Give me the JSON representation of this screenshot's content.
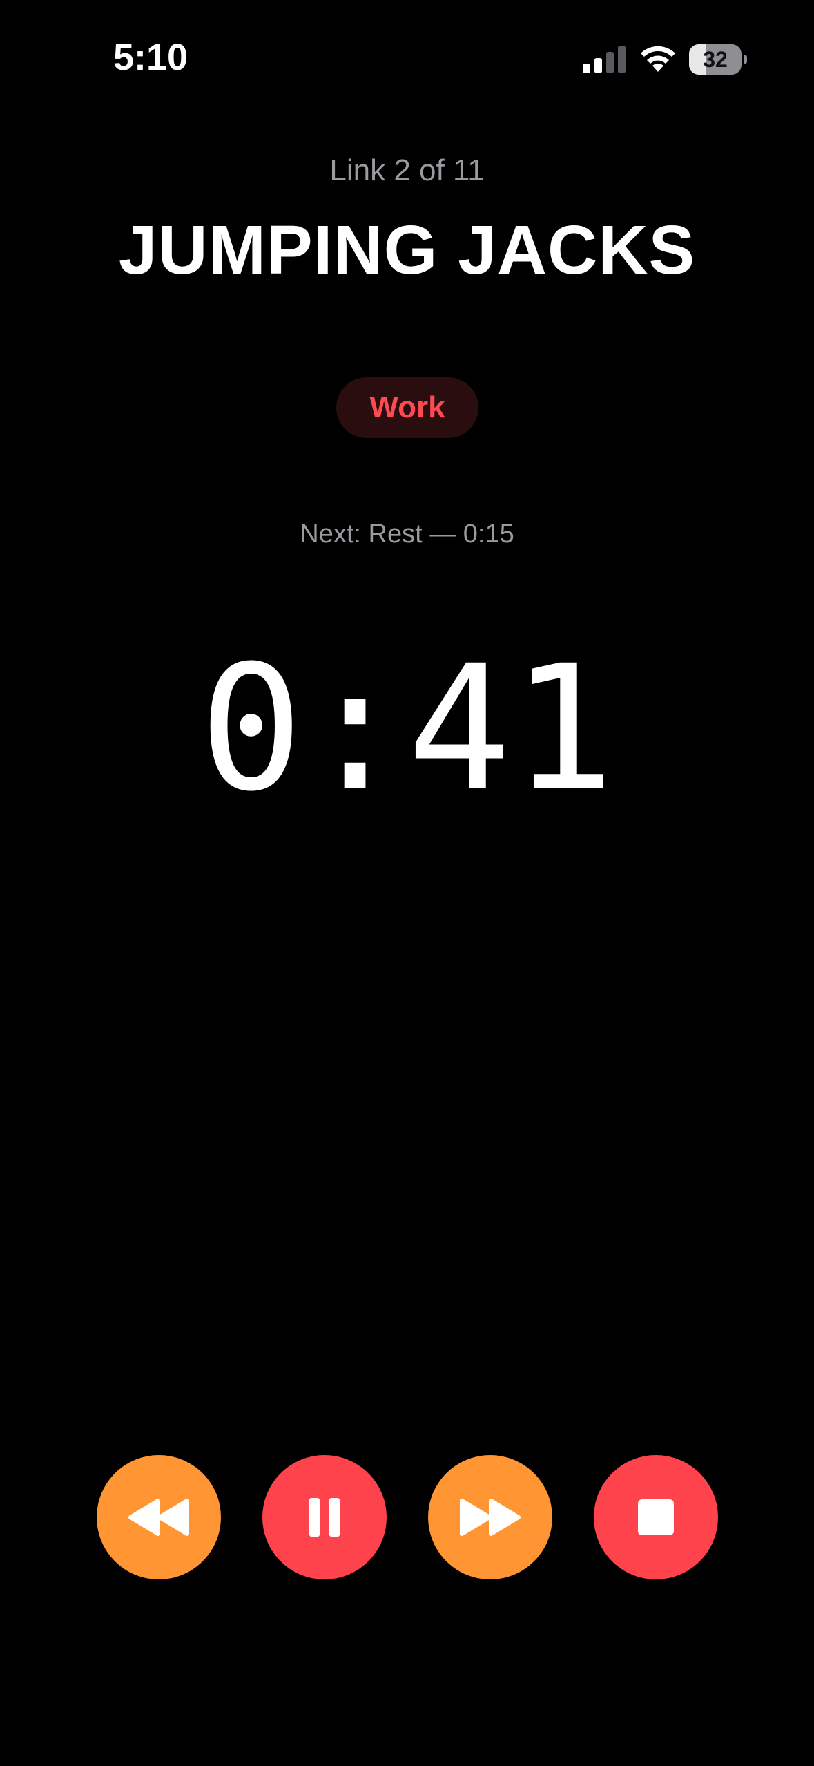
{
  "status_bar": {
    "time": "5:10",
    "battery_level": "32",
    "battery_fraction": 0.32
  },
  "workout": {
    "link_counter": "Link 2 of 11",
    "exercise_name": "JUMPING JACKS",
    "phase": "Work",
    "next_label": "Next: Rest — 0:15",
    "timer": "0:41"
  },
  "controls": {
    "rewind": {
      "icon": "rewind-icon",
      "color": "#ff9533"
    },
    "pause": {
      "icon": "pause-icon",
      "color": "#ff434c"
    },
    "forward": {
      "icon": "fast-forward-icon",
      "color": "#ff9533"
    },
    "stop": {
      "icon": "stop-icon",
      "color": "#ff434c"
    }
  },
  "colors": {
    "background": "#000000",
    "accent_orange": "#ff9533",
    "accent_red": "#ff434c",
    "secondary_text": "#9a9a9f",
    "phase_badge_bg": "#2a0d0f"
  }
}
